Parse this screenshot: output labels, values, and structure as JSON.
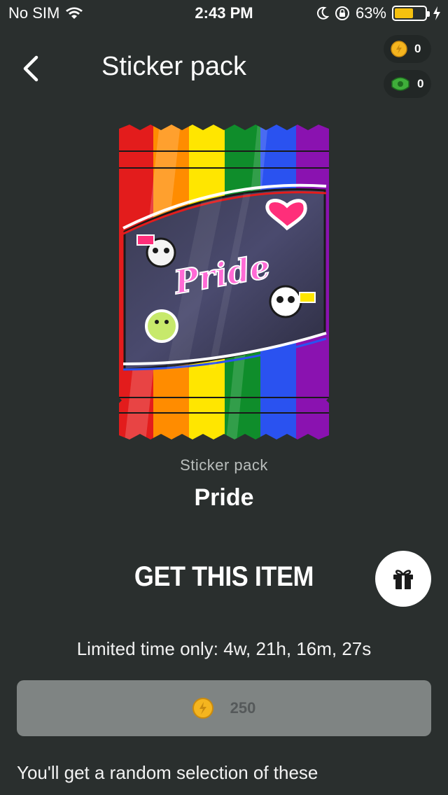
{
  "status_bar": {
    "carrier": "No SIM",
    "time": "2:43 PM",
    "battery_percent": "63%",
    "battery_level": 0.63
  },
  "header": {
    "title": "Sticker pack",
    "coins": "0",
    "cash": "0"
  },
  "pack": {
    "subtitle": "Sticker pack",
    "name": "Pride",
    "art_text": "Pride"
  },
  "purchase": {
    "title": "GET THIS ITEM",
    "limited": "Limited time only: 4w, 21h, 16m, 27s",
    "price": "250",
    "description": "You'll get a random selection of these"
  },
  "icons": {
    "back": "back-chevron-icon",
    "coin": "coin-icon",
    "cash": "cash-icon",
    "gift": "gift-icon"
  },
  "colors": {
    "background": "#2a2f2e",
    "button_disabled": "#7f8483",
    "coin": "#f5b51f",
    "battery": "#f6c10f"
  }
}
